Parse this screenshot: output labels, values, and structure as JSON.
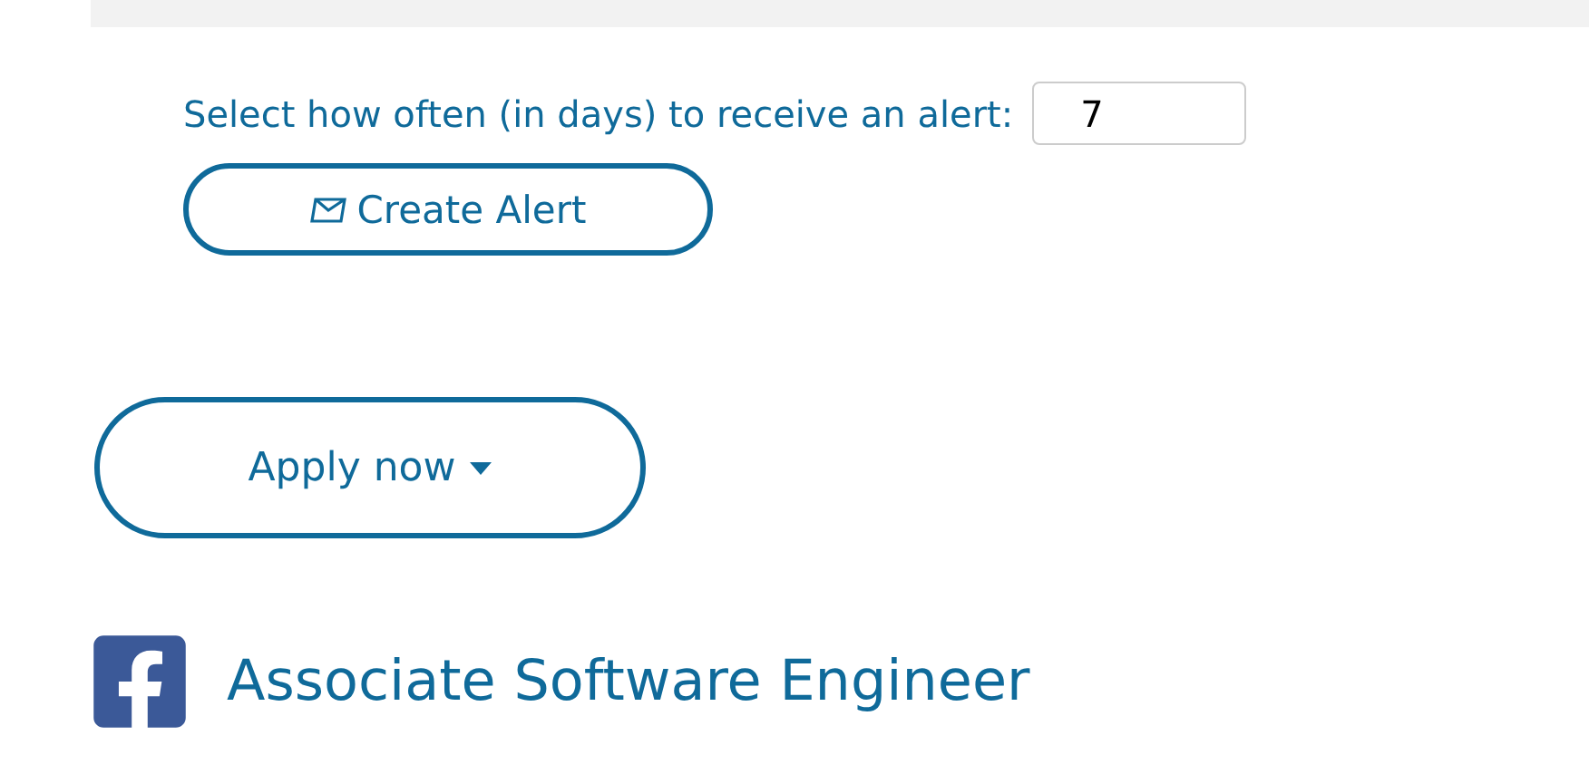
{
  "alert": {
    "label": "Select how often (in days) to receive an alert:",
    "value": "7",
    "button": "Create Alert"
  },
  "apply_button": {
    "label": "Apply now"
  },
  "job": {
    "title": "Associate Software Engineer"
  }
}
